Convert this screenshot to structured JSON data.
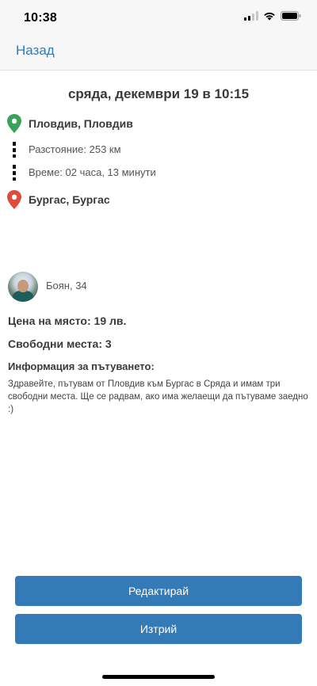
{
  "status_bar": {
    "time": "10:38"
  },
  "nav": {
    "back_label": "Назад"
  },
  "trip": {
    "date_title": "сряда, декември 19 в 10:15",
    "from": "Пловдив, Пловдив",
    "distance": "Разстояние: 253 км",
    "duration": "Време: 02 часа, 13 минути",
    "to": "Бургас, Бургас"
  },
  "driver": {
    "name_age": "Боян, 34"
  },
  "details": {
    "price": "Цена на място: 19 лв.",
    "seats": "Свободни места: 3",
    "info_heading": "Информация за пътуването:",
    "info_text": "Здравейте, пътувам от Пловдив към Бургас в Сряда и имам три свободни места. Ще се радвам, ако има желаещи да пътуваме заедно :)"
  },
  "buttons": {
    "edit_label": "Редактирай",
    "delete_label": "Изтрий"
  },
  "colors": {
    "accent": "#337ab7",
    "start_pin": "#3aa35b",
    "end_pin": "#e04b3c"
  },
  "icons": {
    "start": "map-pin-icon",
    "end": "map-pin-icon",
    "signal": "signal-icon",
    "wifi": "wifi-icon",
    "battery": "battery-icon"
  }
}
